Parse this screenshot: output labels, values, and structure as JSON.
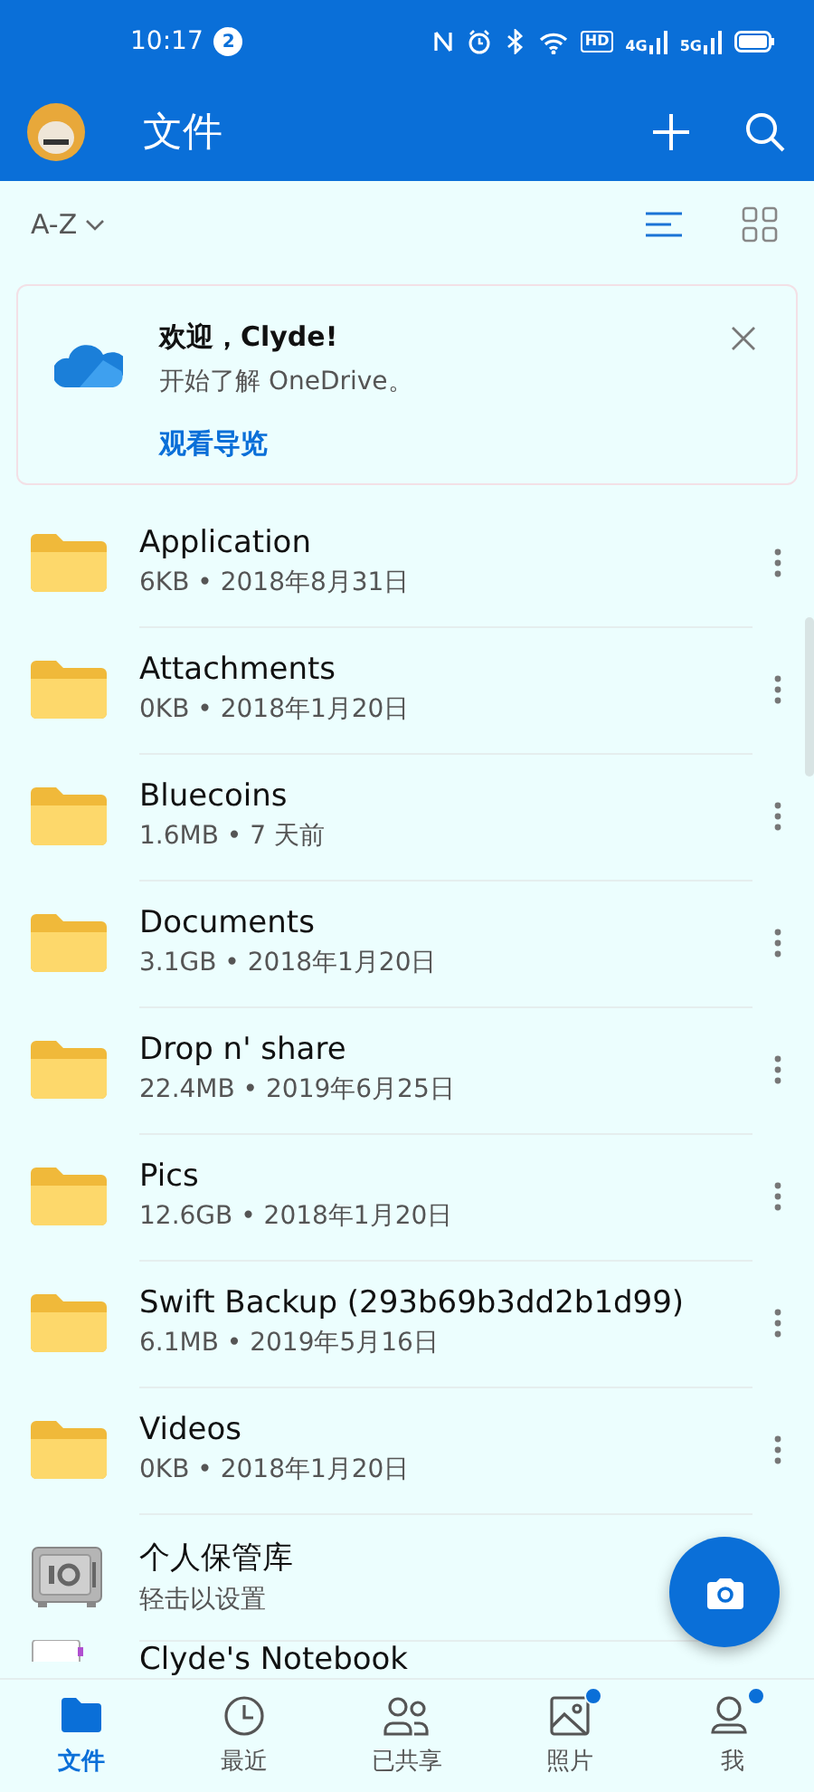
{
  "status_bar": {
    "time": "10:17",
    "notification_count": "2",
    "network_labels": [
      "HD",
      "4G",
      "5G"
    ]
  },
  "app_bar": {
    "title": "文件"
  },
  "toolbar": {
    "sort": "A-Z",
    "view_modes": [
      {
        "kind": "list",
        "selected": true
      },
      {
        "kind": "grid",
        "selected": false
      }
    ]
  },
  "banner": {
    "title": "欢迎，Clyde!",
    "text": "开始了解 OneDrive。",
    "link": "观看导览"
  },
  "files": [
    {
      "kind": "folder",
      "name": "Application",
      "details": "6KB • 2018年8月31日"
    },
    {
      "kind": "folder",
      "name": "Attachments",
      "details": "0KB • 2018年1月20日"
    },
    {
      "kind": "folder",
      "name": "Bluecoins",
      "details": "1.6MB • 7 天前"
    },
    {
      "kind": "folder",
      "name": "Documents",
      "details": "3.1GB • 2018年1月20日"
    },
    {
      "kind": "folder",
      "name": "Drop n' share",
      "details": "22.4MB • 2019年6月25日"
    },
    {
      "kind": "folder",
      "name": "Pics",
      "details": "12.6GB • 2018年1月20日"
    },
    {
      "kind": "folder",
      "name": "Swift Backup (293b69b3dd2b1d99)",
      "details": "6.1MB • 2019年5月16日"
    },
    {
      "kind": "folder",
      "name": "Videos",
      "details": "0KB • 2018年1月20日"
    },
    {
      "kind": "vault",
      "name": "个人保管库",
      "details": "轻击以设置"
    },
    {
      "kind": "notebook",
      "name": "Clyde's Notebook"
    }
  ],
  "nav": [
    {
      "kind": "files",
      "label": "文件",
      "selected": true,
      "badge": false
    },
    {
      "kind": "recent",
      "label": "最近",
      "selected": false,
      "badge": false
    },
    {
      "kind": "shared",
      "label": "已共享",
      "selected": false,
      "badge": false
    },
    {
      "kind": "photos",
      "label": "照片",
      "selected": false,
      "badge": true
    },
    {
      "kind": "me",
      "label": "我",
      "selected": false,
      "badge": true
    }
  ]
}
